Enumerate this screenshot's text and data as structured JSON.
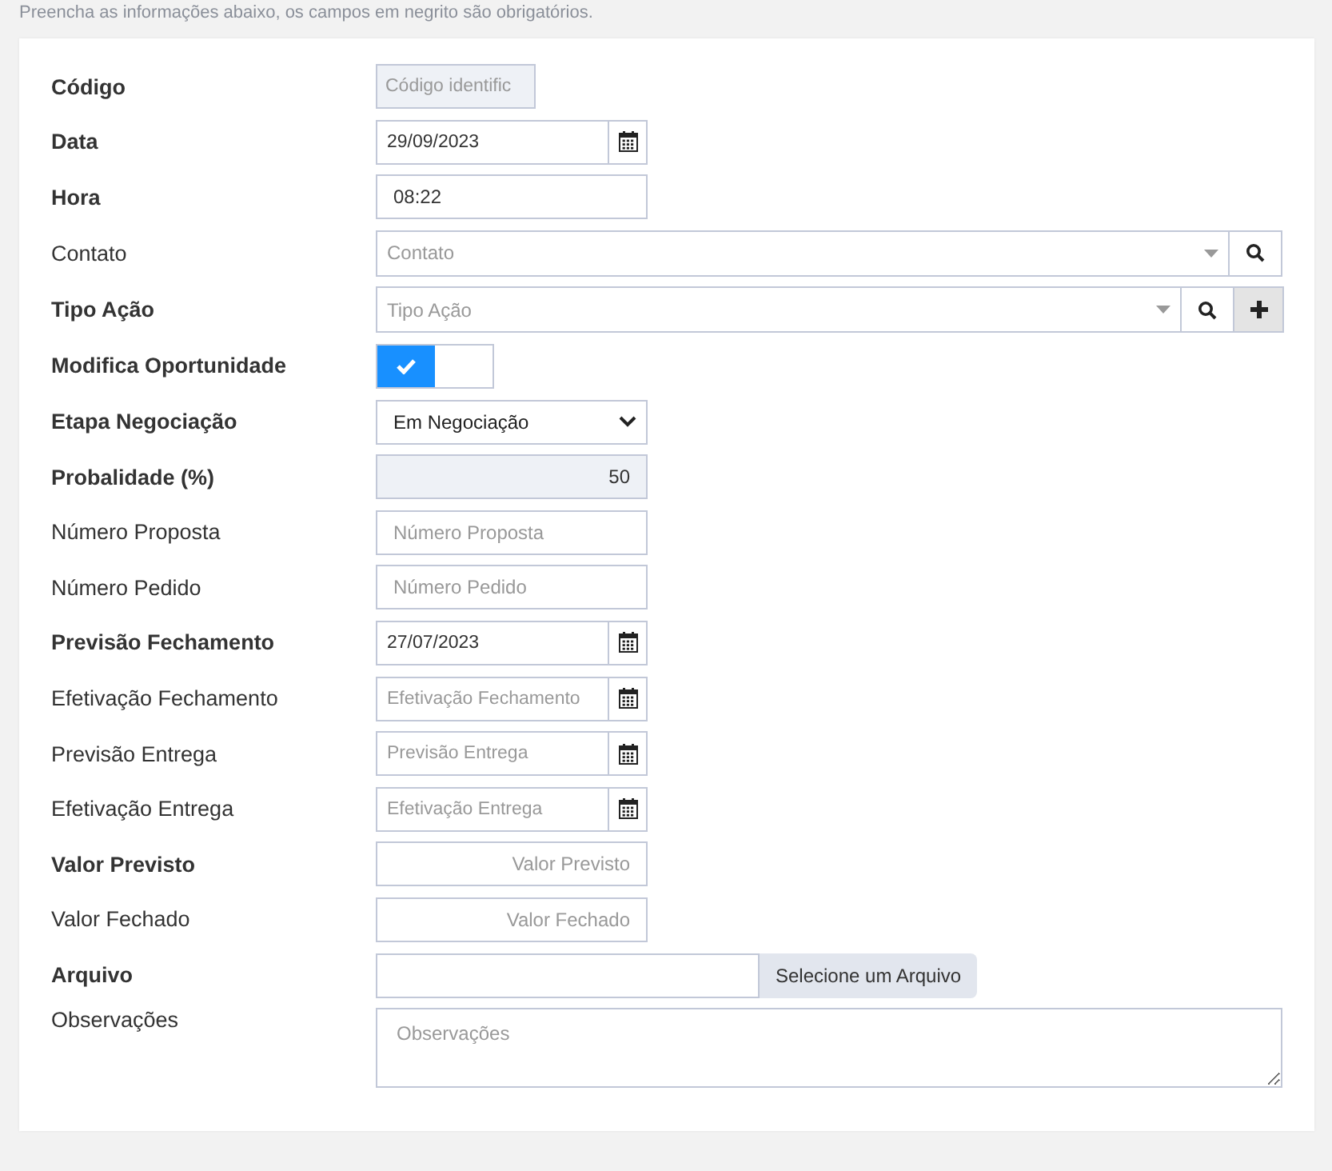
{
  "intro": "Preencha as informações abaixo, os campos em negrito são obrigatórios.",
  "fields": [
    {
      "label": "Código",
      "required": true,
      "kind": "text",
      "disabled": true,
      "placeholder": "Código identific"
    },
    {
      "label": "Data",
      "required": true,
      "kind": "date",
      "value": "29/09/2023"
    },
    {
      "label": "Hora",
      "required": true,
      "kind": "text",
      "disabled": false,
      "value": "08:22"
    },
    {
      "label": "Contato",
      "required": false,
      "kind": "lookup",
      "placeholder": "Contato",
      "add": false
    },
    {
      "label": "Tipo Ação",
      "required": true,
      "kind": "lookup",
      "placeholder": "Tipo Ação",
      "add": true
    },
    {
      "label": "Modifica Oportunidade",
      "required": true,
      "kind": "toggle",
      "on": true
    },
    {
      "label": "Etapa Negociação",
      "required": true,
      "kind": "select",
      "value": "Em Negociação"
    },
    {
      "label": "Probalidade (%)",
      "required": true,
      "kind": "number",
      "disabled": true,
      "value": "50"
    },
    {
      "label": "Número Proposta",
      "required": false,
      "kind": "text",
      "disabled": false,
      "placeholder": "Número Proposta"
    },
    {
      "label": "Número Pedido",
      "required": false,
      "kind": "text",
      "disabled": false,
      "placeholder": "Número Pedido"
    },
    {
      "label": "Previsão Fechamento",
      "required": true,
      "kind": "date",
      "value": "27/07/2023"
    },
    {
      "label": "Efetivação Fechamento",
      "required": false,
      "kind": "date",
      "placeholder": "Efetivação Fechamento"
    },
    {
      "label": "Previsão Entrega",
      "required": false,
      "kind": "date",
      "placeholder": "Previsão Entrega"
    },
    {
      "label": "Efetivação Entrega",
      "required": false,
      "kind": "date",
      "placeholder": "Efetivação Entrega"
    },
    {
      "label": "Valor Previsto",
      "required": true,
      "kind": "money",
      "placeholder": "Valor Previsto"
    },
    {
      "label": "Valor Fechado",
      "required": false,
      "kind": "money",
      "placeholder": "Valor Fechado"
    },
    {
      "label": "Arquivo",
      "required": true,
      "kind": "file",
      "button": "Selecione um Arquivo"
    },
    {
      "label": "Observações",
      "required": false,
      "kind": "textarea",
      "placeholder": "Observações"
    }
  ]
}
